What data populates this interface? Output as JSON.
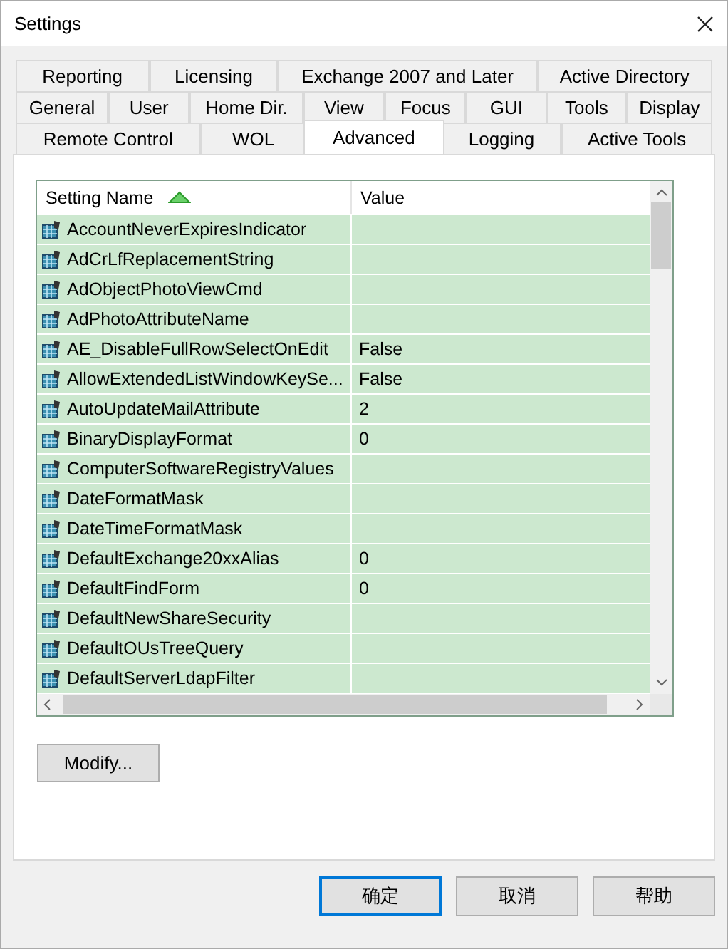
{
  "window": {
    "title": "Settings"
  },
  "tab_rows": [
    [
      {
        "label": "Reporting",
        "selected": false
      },
      {
        "label": "Licensing",
        "selected": false
      },
      {
        "label": "Exchange 2007 and Later",
        "selected": false
      },
      {
        "label": "Active Directory",
        "selected": false
      }
    ],
    [
      {
        "label": "General",
        "selected": false
      },
      {
        "label": "User",
        "selected": false
      },
      {
        "label": "Home Dir.",
        "selected": false
      },
      {
        "label": "View",
        "selected": false
      },
      {
        "label": "Focus",
        "selected": false
      },
      {
        "label": "GUI",
        "selected": false
      },
      {
        "label": "Tools",
        "selected": false
      },
      {
        "label": "Display",
        "selected": false
      }
    ],
    [
      {
        "label": "Remote Control",
        "selected": false
      },
      {
        "label": "WOL",
        "selected": false
      },
      {
        "label": "Advanced",
        "selected": true
      },
      {
        "label": "Logging",
        "selected": false
      },
      {
        "label": "Active Tools",
        "selected": false
      }
    ]
  ],
  "table": {
    "columns": [
      {
        "label": "Setting Name",
        "sorted": true
      },
      {
        "label": "Value",
        "sorted": false
      }
    ],
    "rows": [
      {
        "name": "AccountNeverExpiresIndicator",
        "value": ""
      },
      {
        "name": "AdCrLfReplacementString",
        "value": ""
      },
      {
        "name": "AdObjectPhotoViewCmd",
        "value": ""
      },
      {
        "name": "AdPhotoAttributeName",
        "value": ""
      },
      {
        "name": "AE_DisableFullRowSelectOnEdit",
        "value": "False"
      },
      {
        "name": "AllowExtendedListWindowKeySe...",
        "value": "False"
      },
      {
        "name": "AutoUpdateMailAttribute",
        "value": "2"
      },
      {
        "name": "BinaryDisplayFormat",
        "value": "0"
      },
      {
        "name": "ComputerSoftwareRegistryValues",
        "value": ""
      },
      {
        "name": "DateFormatMask",
        "value": ""
      },
      {
        "name": "DateTimeFormatMask",
        "value": ""
      },
      {
        "name": "DefaultExchange20xxAlias",
        "value": "0"
      },
      {
        "name": "DefaultFindForm",
        "value": "0"
      },
      {
        "name": "DefaultNewShareSecurity",
        "value": ""
      },
      {
        "name": "DefaultOUsTreeQuery",
        "value": ""
      },
      {
        "name": "DefaultServerLdapFilter",
        "value": ""
      }
    ]
  },
  "modify_button": "Modify...",
  "buttons": [
    {
      "label": "确定",
      "default": true
    },
    {
      "label": "取消",
      "default": false
    },
    {
      "label": "帮助",
      "default": false
    }
  ]
}
